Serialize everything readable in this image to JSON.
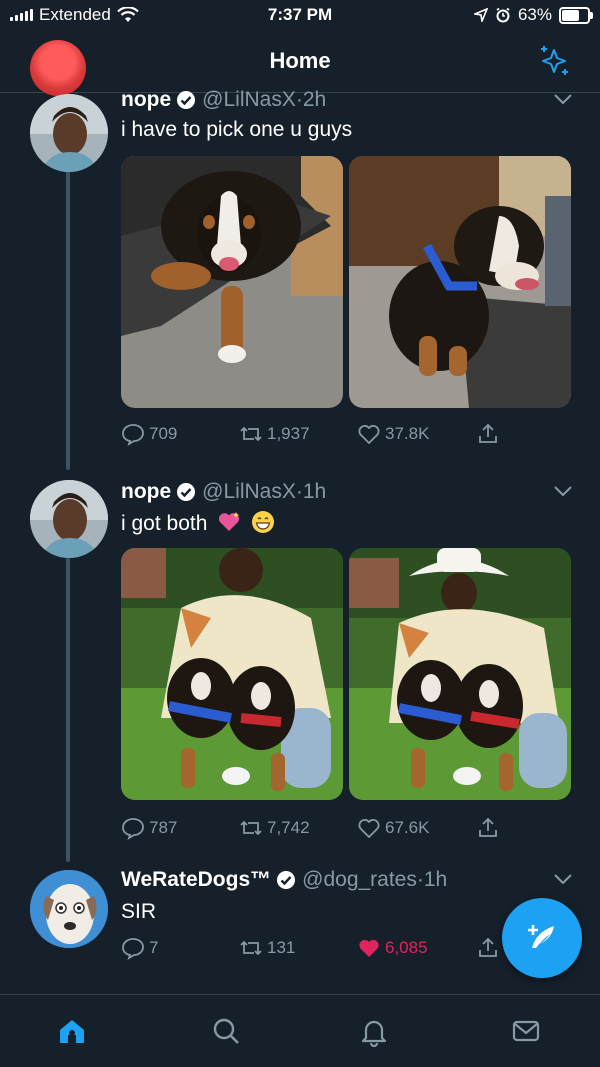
{
  "status_bar": {
    "carrier": "Extended",
    "time": "7:37 PM",
    "battery_percent": "63%",
    "battery_level": 0.63
  },
  "header": {
    "title": "Home",
    "left_icon": "profile-avatar-redacted",
    "right_icon": "sparkle-icon"
  },
  "tweets": [
    {
      "name": "nope",
      "verified": true,
      "handle": "@LilNasX",
      "separator": "·",
      "time": "2h",
      "text": "i have to pick one u guys",
      "media": [
        "puppy-on-mat-photo",
        "puppy-blue-harness-photo"
      ],
      "replies": "709",
      "retweets": "1,937",
      "likes": "37.8K",
      "liked": false
    },
    {
      "name": "nope",
      "verified": true,
      "handle": "@LilNasX",
      "separator": "·",
      "time": "1h",
      "text": "i got both",
      "emojis": [
        "sparkling-heart-emoji",
        "grinning-face-emoji"
      ],
      "media": [
        "man-with-two-puppies-photo",
        "cowboy-hat-man-with-two-puppies-photo"
      ],
      "replies": "787",
      "retweets": "7,742",
      "likes": "67.6K",
      "liked": false
    },
    {
      "name": "WeRateDogs™",
      "verified": true,
      "handle": "@dog_rates",
      "separator": "·",
      "time": "1h",
      "text": "SIR",
      "replies": "7",
      "retweets": "131",
      "likes": "6,085",
      "liked": true
    }
  ],
  "compose_button": "compose-tweet-icon",
  "tabs": [
    "home-icon",
    "search-icon",
    "notifications-bell-icon",
    "messages-envelope-icon"
  ],
  "colors": {
    "background": "#15202b",
    "accent": "#1da1f2",
    "secondary_text": "#8899a6",
    "like": "#e0245e",
    "divider": "#38444d"
  }
}
